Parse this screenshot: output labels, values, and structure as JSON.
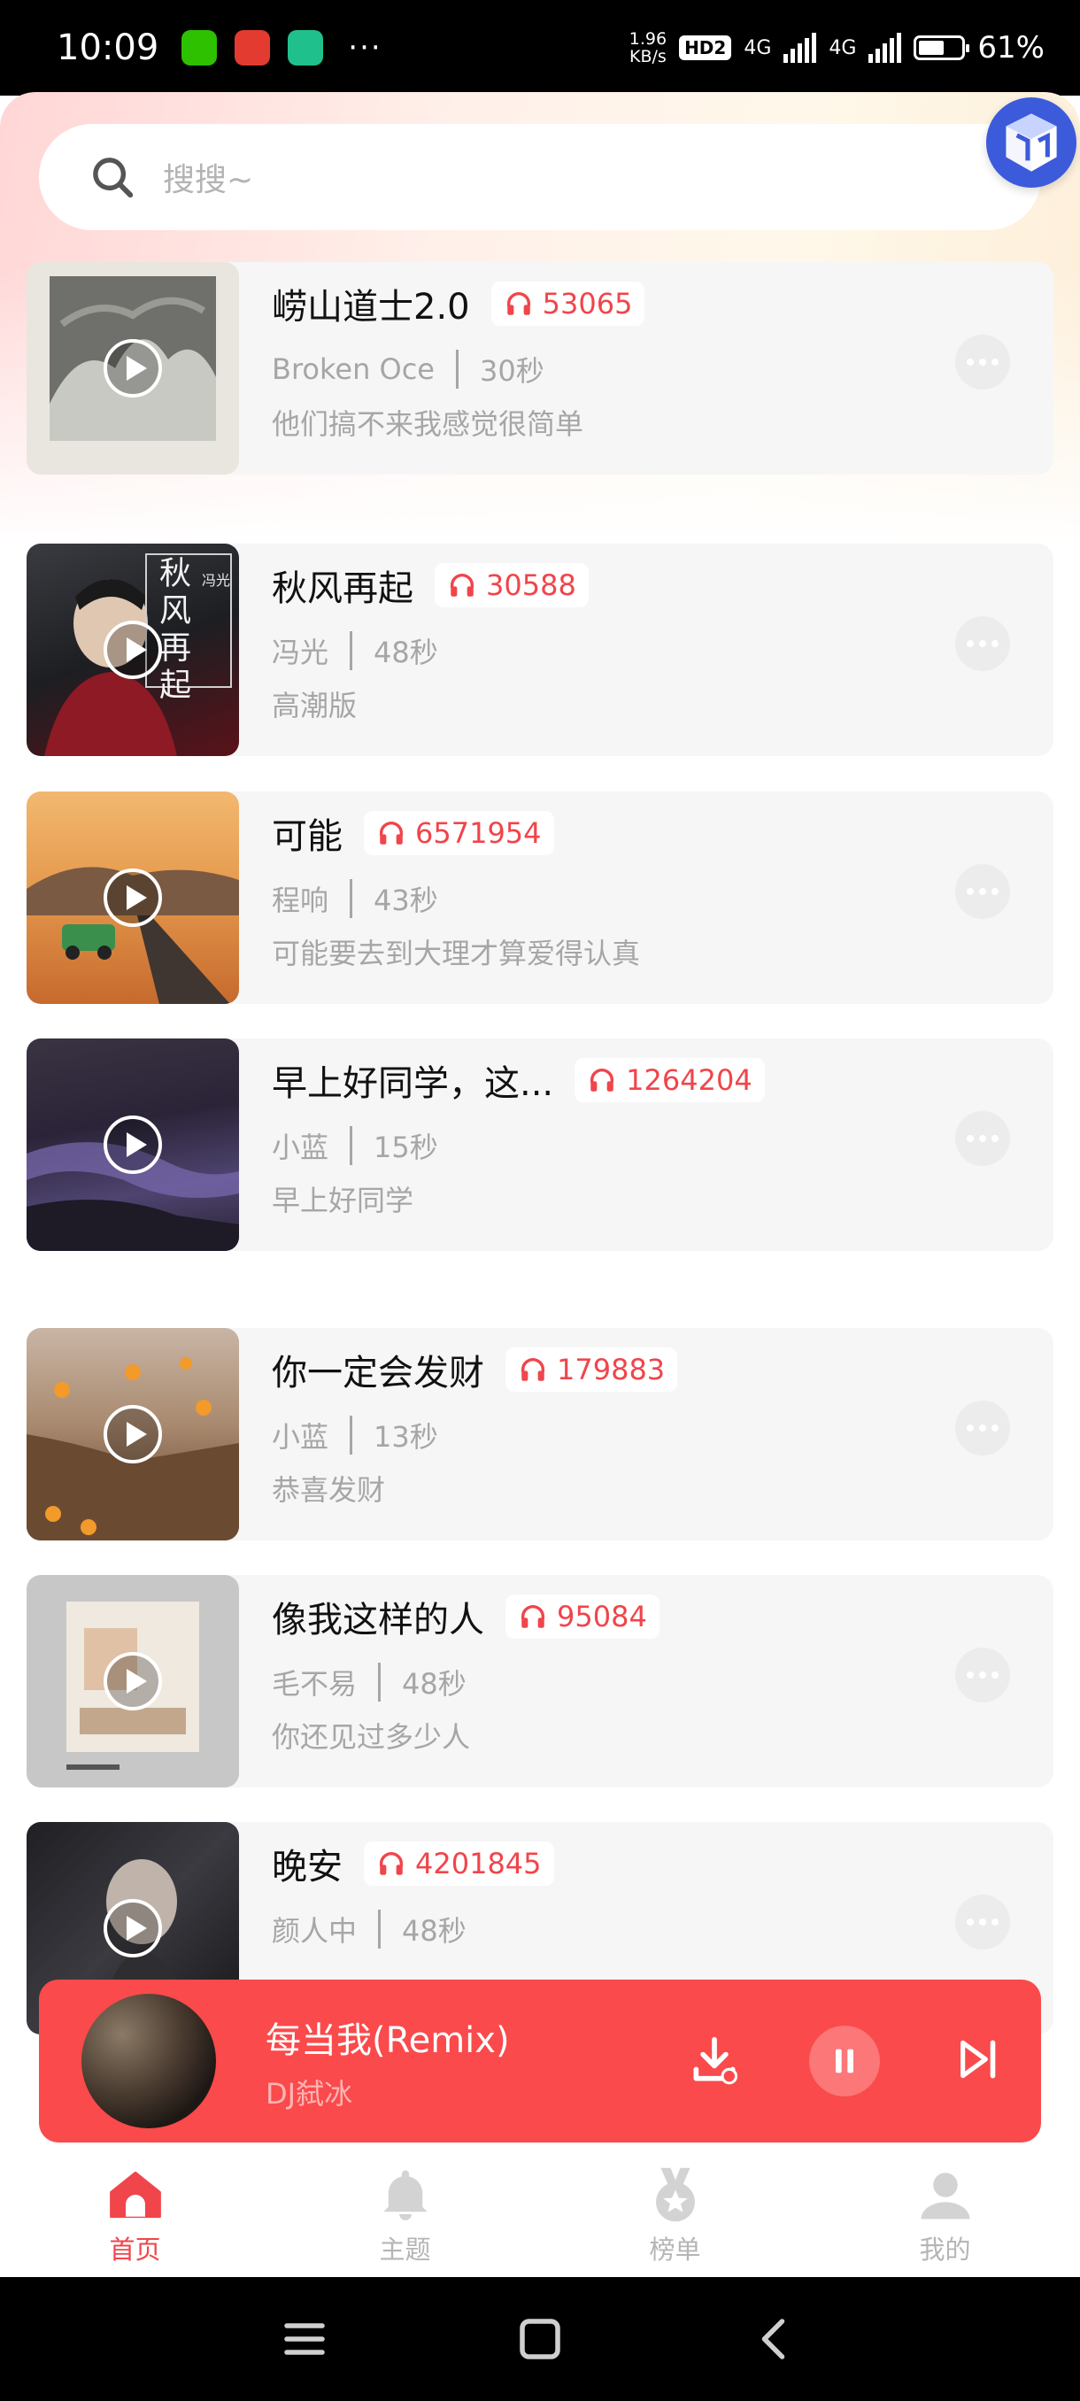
{
  "status_bar": {
    "time": "10:09",
    "net_speed_value": "1.96",
    "net_speed_unit": "KB/s",
    "hd": "HD2",
    "signal1_label": "4G",
    "signal2_label": "4G",
    "battery": "61%",
    "battery_level": 0.61,
    "overflow": "···"
  },
  "search": {
    "placeholder": "搜搜~"
  },
  "songs": [
    {
      "title": "崂山道士2.0",
      "plays": "53065",
      "artist": "Broken Oce",
      "duration": "30秒",
      "desc": "他们搞不来我感觉很简单"
    },
    {
      "title": "秋风再起",
      "plays": "30588",
      "artist": "冯光",
      "duration": "48秒",
      "desc": "高潮版",
      "cover_text": "秋风再起",
      "cover_artist": "冯光"
    },
    {
      "title": "可能",
      "plays": "6571954",
      "artist": "程响",
      "duration": "43秒",
      "desc": "可能要去到大理才算爱得认真"
    },
    {
      "title": "早上好同学，这...",
      "plays": "1264204",
      "artist": "小蓝",
      "duration": "15秒",
      "desc": "早上好同学"
    },
    {
      "title": "你一定会发财",
      "plays": "179883",
      "artist": "小蓝",
      "duration": "13秒",
      "desc": "恭喜发财"
    },
    {
      "title": "像我这样的人",
      "plays": "95084",
      "artist": "毛不易",
      "duration": "48秒",
      "desc": "你还见过多少人"
    },
    {
      "title": "晚安",
      "plays": "4201845",
      "artist": "颜人中",
      "duration": "48秒",
      "desc": ""
    }
  ],
  "player": {
    "title": "每当我(Remix)",
    "artist": "DJ弑冰"
  },
  "tabs": [
    {
      "label": "首页",
      "icon": "home-icon"
    },
    {
      "label": "主题",
      "icon": "bell-icon"
    },
    {
      "label": "榜单",
      "icon": "medal-icon"
    },
    {
      "label": "我的",
      "icon": "profile-icon"
    }
  ],
  "colors": {
    "accent": "#f0454b",
    "player_bg": "#fa4a4b",
    "card_bg": "#f6f6f6",
    "muted_text": "#a6a6a6"
  }
}
